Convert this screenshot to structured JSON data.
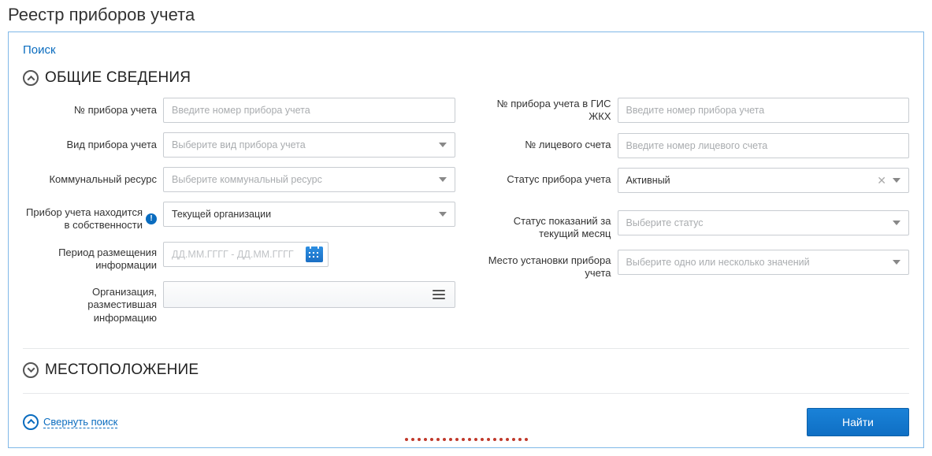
{
  "page_title": "Реестр приборов учета",
  "search_title": "Поиск",
  "sections": {
    "general": {
      "title": "ОБЩИЕ СВЕДЕНИЯ"
    },
    "location": {
      "title": "МЕСТОПОЛОЖЕНИЕ"
    }
  },
  "left": {
    "meter_no": {
      "label": "№ прибора учета",
      "placeholder": "Введите номер прибора учета"
    },
    "meter_type": {
      "label": "Вид прибора учета",
      "placeholder": "Выберите вид прибора учета"
    },
    "resource": {
      "label": "Коммунальный ресурс",
      "placeholder": "Выберите коммунальный ресурс"
    },
    "ownership": {
      "label": "Прибор учета находится в собственности",
      "value": "Текущей организации"
    },
    "period": {
      "label": "Период размещения информации",
      "from_ph": "ДД.ММ.ГГГГ",
      "sep": "-",
      "to_ph": "ДД.ММ.ГГГГ"
    },
    "publisher": {
      "label": "Организация, разместившая информацию"
    }
  },
  "right": {
    "gis_no": {
      "label": "№ прибора учета в ГИС ЖКХ",
      "placeholder": "Введите номер прибора учета"
    },
    "account_no": {
      "label": "№ лицевого счета",
      "placeholder": "Введите номер лицевого счета"
    },
    "status": {
      "label": "Статус прибора учета",
      "value": "Активный"
    },
    "readings_status": {
      "label": "Статус показаний за текущий месяц",
      "placeholder": "Выберите статус"
    },
    "install_place": {
      "label": "Место установки прибора учета",
      "placeholder": "Выберите одно или несколько значений"
    }
  },
  "footer": {
    "collapse": "Свернуть поиск",
    "submit": "Найти"
  }
}
